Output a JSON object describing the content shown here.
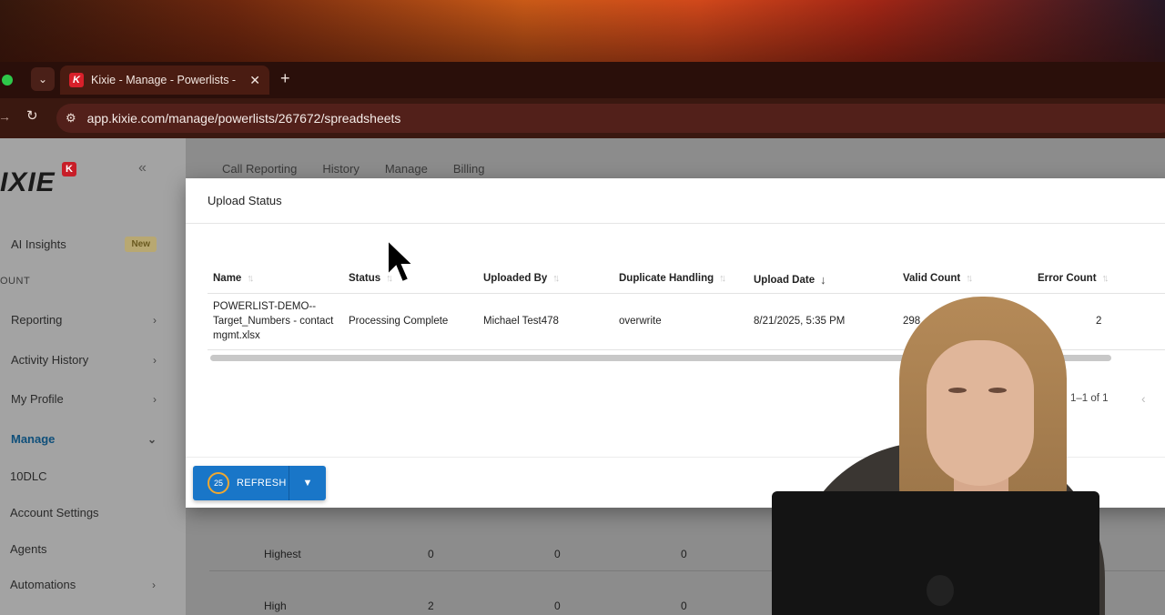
{
  "browser": {
    "tab_title": "Kixie - Manage - Powerlists -",
    "url": "app.kixie.com/manage/powerlists/267672/spreadsheets"
  },
  "sidebar": {
    "logo": "IXIE",
    "logo_badge": "K",
    "section_label": "OUNT",
    "items": [
      {
        "label": "AI Insights",
        "badge": "New"
      },
      {
        "label": "Reporting"
      },
      {
        "label": "Activity History"
      },
      {
        "label": "My Profile"
      },
      {
        "label": "Manage"
      },
      {
        "label": "10DLC"
      },
      {
        "label": "Account Settings"
      },
      {
        "label": "Agents"
      },
      {
        "label": "Automations"
      }
    ]
  },
  "main_nav": [
    "Call Reporting",
    "History",
    "Manage",
    "Billing"
  ],
  "background_table": [
    {
      "priority": "Highest",
      "c1": "0",
      "c2": "0",
      "c3": "0"
    },
    {
      "priority": "High",
      "c1": "2",
      "c2": "0",
      "c3": "0"
    }
  ],
  "modal": {
    "title": "Upload Status",
    "columns": [
      "Name",
      "Status",
      "Uploaded By",
      "Duplicate Handling",
      "Upload Date",
      "Valid Count",
      "Error Count"
    ],
    "rows": [
      {
        "name_lines": [
          "POWERLIST-DEMO--",
          "Target_Numbers - contact",
          "mgmt.xlsx"
        ],
        "status": "Processing Complete",
        "uploaded_by": "Michael Test478",
        "duplicate_handling": "overwrite",
        "upload_date": "8/21/2025, 5:35 PM",
        "valid_count": "298",
        "error_count": "2"
      }
    ],
    "pagination": "1–1 of 1",
    "refresh": {
      "countdown": "25",
      "label": "REFRESH"
    }
  }
}
